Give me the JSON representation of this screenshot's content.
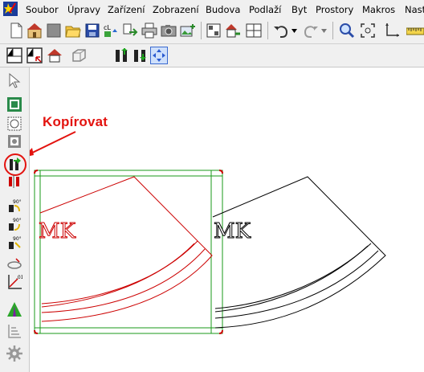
{
  "app": {
    "icon": "pencil-star-app-icon"
  },
  "menu": {
    "items": [
      "Soubor",
      "Úpravy",
      "Zařízení",
      "Zobrazení",
      "Budova",
      "Podlaží",
      "Byt",
      "Prostory",
      "Makros",
      "Nast"
    ]
  },
  "toolbar_top": {
    "icons": [
      "new-document-icon",
      "house-open-icon",
      "gray-square-icon",
      "open-folder-icon",
      "save-icon",
      "convert-icon",
      "export-icon",
      "print-icon",
      "camera-icon",
      "add-picture-icon",
      "building-view-icon",
      "house-arrow-icon",
      "window-grid-icon",
      "undo-icon",
      "redo-icon",
      "zoom-icon",
      "zoom-fit-icon",
      "axes-icon",
      "ruler-icon"
    ]
  },
  "toolbar_second": {
    "icons": [
      "floor-plan-icon",
      "floor-plan-select-icon",
      "roof-view-icon",
      "3d-box-icon",
      "move-figures-icon",
      "swap-figures-icon",
      "pointer-frame-icon"
    ]
  },
  "left_toolbar": {
    "icons": [
      "select-arrow-icon",
      "select-region-icon",
      "select-all-icon",
      "select-frame-icon",
      "copy-icon",
      "mirror-icon",
      "rotate-90-icon",
      "rotate-90-ccw-icon",
      "rotate-90-alt-icon",
      "ellipse-tool-icon",
      "scale-axis-icon",
      "triangle-tool-icon",
      "stairs-icon",
      "gear-icon"
    ]
  },
  "annotation": {
    "label": "Kopírovat",
    "color": "#e3130f"
  },
  "drawing": {
    "left_text": "MK",
    "right_text": "MK",
    "colors": {
      "selected": "#cc0000",
      "normal": "#000000",
      "selection_box": "#1a9a1a"
    }
  }
}
